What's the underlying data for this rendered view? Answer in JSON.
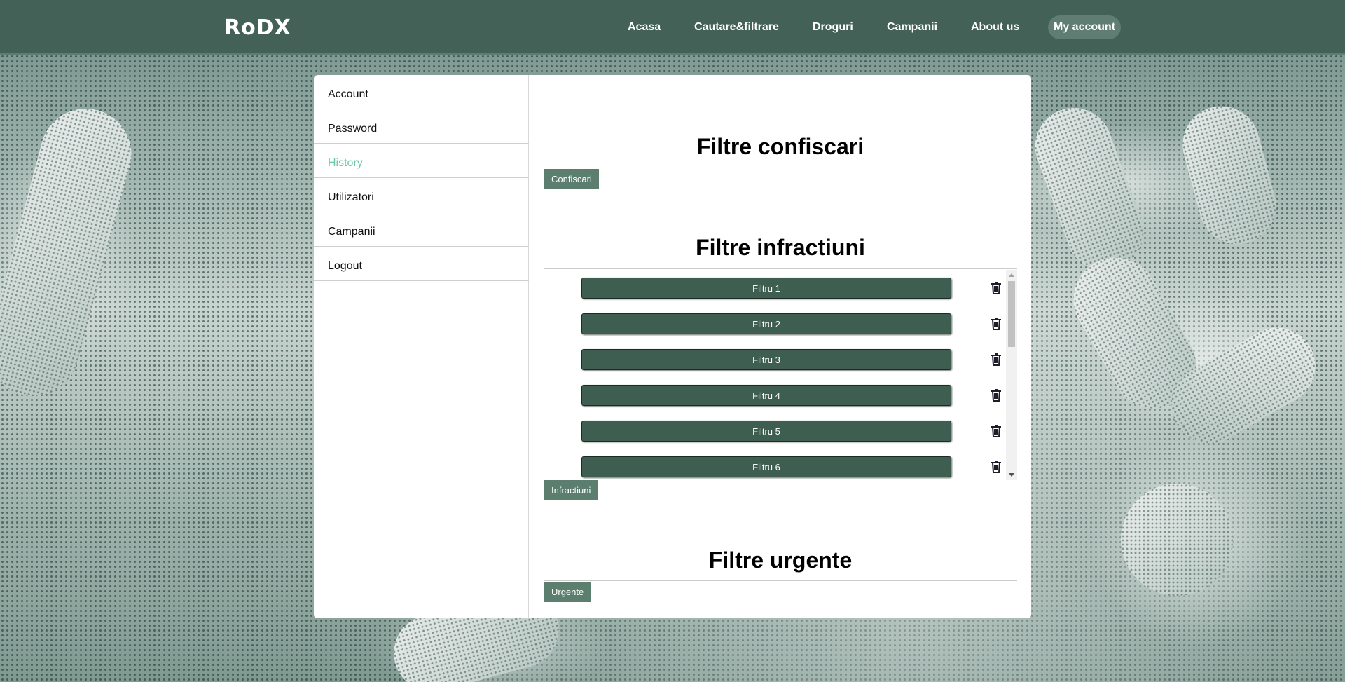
{
  "brand": {
    "logo": "RoDX"
  },
  "nav": {
    "items": [
      {
        "label": "Acasa"
      },
      {
        "label": "Cautare&filtrare"
      },
      {
        "label": "Droguri"
      },
      {
        "label": "Campanii"
      },
      {
        "label": "About us"
      },
      {
        "label": "My account"
      }
    ],
    "active": "My account"
  },
  "sidebar": {
    "items": [
      {
        "label": "Account"
      },
      {
        "label": "Password"
      },
      {
        "label": "History"
      },
      {
        "label": "Utilizatori"
      },
      {
        "label": "Campanii"
      },
      {
        "label": "Logout"
      }
    ],
    "active": "History"
  },
  "sections": {
    "confiscari": {
      "title": "Filtre confiscari",
      "button": "Confiscari"
    },
    "infractiuni": {
      "title": "Filtre infractiuni",
      "button": "Infractiuni",
      "filters": [
        {
          "label": "Filtru 1",
          "icon": "trash-icon"
        },
        {
          "label": "Filtru 2",
          "icon": "trash-icon"
        },
        {
          "label": "Filtru 3",
          "icon": "trash-icon"
        },
        {
          "label": "Filtru 4",
          "icon": "trash-icon"
        },
        {
          "label": "Filtru 5",
          "icon": "trash-icon"
        },
        {
          "label": "Filtru 6",
          "icon": "trash-icon"
        }
      ]
    },
    "urgente": {
      "title": "Filtre urgente",
      "button": "Urgente"
    }
  },
  "colors": {
    "header": "#436157",
    "active_link": "#6bc9a4",
    "filter_button": "#3f5e52",
    "small_button": "#5b7e6f"
  }
}
